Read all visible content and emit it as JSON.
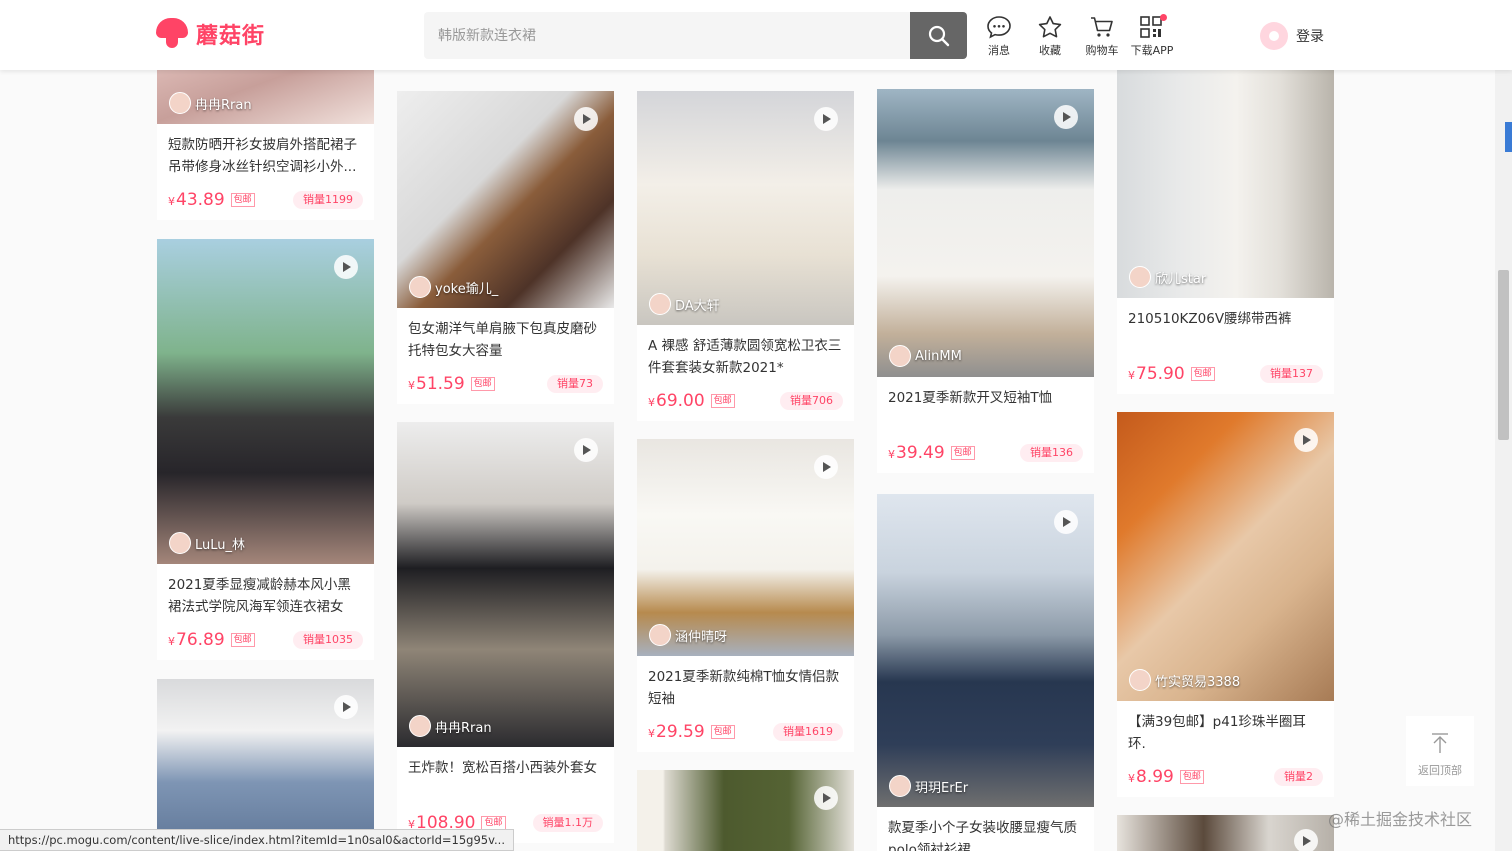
{
  "header": {
    "brand": "蘑菇街",
    "search_placeholder": "韩版新款连衣裙",
    "nav": [
      {
        "label": "消息",
        "icon": "message-icon"
      },
      {
        "label": "收藏",
        "icon": "star-icon"
      },
      {
        "label": "购物车",
        "icon": "cart-icon"
      },
      {
        "label": "下载APP",
        "icon": "qrcode-icon"
      }
    ],
    "login_label": "登录"
  },
  "currency": "¥",
  "free_shipping_label": "包邮",
  "products": [
    {
      "id": "c1",
      "author": "冉冉Rran",
      "title": "短款防晒开衫女披肩外搭配裙子吊带修身冰丝针织空调衫小外...",
      "price": "43.89",
      "sales": "销量1199"
    },
    {
      "id": "c2",
      "author": "LuLu_林",
      "title": "2021夏季显瘦减龄赫本风小黑裙法式学院风海军领连衣裙女",
      "price": "76.89",
      "sales": "销量1035"
    },
    {
      "id": "c3",
      "author": "",
      "title": "",
      "price": "",
      "sales": ""
    },
    {
      "id": "c4",
      "author": "yoke瑜儿_",
      "title": "包女潮洋气单肩腋下包真皮磨砂托特包女大容量",
      "price": "51.59",
      "sales": "销量73"
    },
    {
      "id": "c5",
      "author": "冉冉Rran",
      "title": "王炸款！宽松百搭小西装外套女",
      "price": "108.90",
      "sales": "销量1.1万"
    },
    {
      "id": "c6",
      "author": "DA大轩",
      "title": "A 裸感 舒适薄款圆领宽松卫衣三件套套装女新款2021*",
      "price": "69.00",
      "sales": "销量706"
    },
    {
      "id": "c7",
      "author": "涵仲晴呀",
      "title": "2021夏季新款纯棉T恤女情侣款短袖",
      "price": "29.59",
      "sales": "销量1619"
    },
    {
      "id": "c8",
      "author": "",
      "title": "",
      "price": "",
      "sales": ""
    },
    {
      "id": "c9",
      "author": "AlinMM",
      "title": "2021夏季新款开叉短袖T恤",
      "price": "39.49",
      "sales": "销量136"
    },
    {
      "id": "c10",
      "author": "玥玥ErEr",
      "title": "款夏季小个子女装收腰显瘦气质polo领衬衫裙",
      "price": "",
      "sales": ""
    },
    {
      "id": "c11",
      "author": "欣儿star",
      "title": "210510KZ06V腰绑带西裤",
      "price": "75.90",
      "sales": "销量137"
    },
    {
      "id": "c12",
      "author": "竹实贸易3388",
      "title": "【满39包邮】p41珍珠半圈耳环.",
      "price": "8.99",
      "sales": "销量2"
    },
    {
      "id": "c13",
      "author": "",
      "title": "",
      "price": "",
      "sales": ""
    }
  ],
  "backtop_label": "返回顶部",
  "status_url": "https://pc.mogu.com/content/live-slice/index.html?itemId=1n0sal0&actorId=15g95v...",
  "watermark": "@稀土掘金技术社区"
}
